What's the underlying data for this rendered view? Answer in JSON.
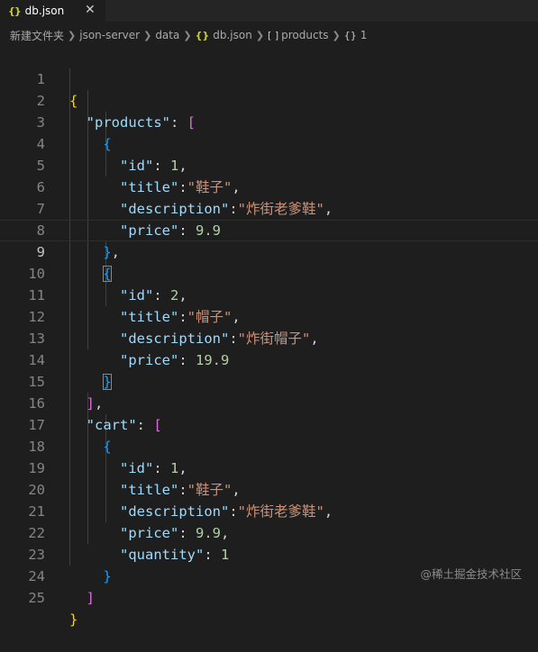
{
  "tab": {
    "icon": "{}",
    "label": "db.json",
    "close": "✕"
  },
  "breadcrumb": [
    "新建文件夹",
    "json-server",
    "data",
    "db.json",
    "products",
    "1"
  ],
  "line_numbers": [
    "1",
    "2",
    "3",
    "4",
    "5",
    "6",
    "7",
    "8",
    "9",
    "10",
    "11",
    "12",
    "13",
    "14",
    "15",
    "16",
    "17",
    "18",
    "19",
    "20",
    "21",
    "22",
    "23",
    "24",
    "25"
  ],
  "code": {
    "products_key": "\"products\"",
    "cart_key": "\"cart\"",
    "id_key": "\"id\"",
    "title_key": "\"title\"",
    "description_key": "\"description\"",
    "price_key": "\"price\"",
    "quantity_key": "\"quantity\"",
    "item1_id": "1",
    "item1_title": "\"鞋子\"",
    "item1_desc": "\"炸街老爹鞋\"",
    "item1_price": "9.9",
    "item2_id": "2",
    "item2_title": "\"帽子\"",
    "item2_desc": "\"炸街帽子\"",
    "item2_price": "19.9",
    "cart1_id": "1",
    "cart1_title": "\"鞋子\"",
    "cart1_desc": "\"炸街老爹鞋\"",
    "cart1_price": "9.9",
    "cart1_quantity": "1"
  },
  "watermark": "@稀土掘金技术社区",
  "colors": {
    "background": "#1e1e1e",
    "key": "#9cdcfe",
    "string": "#ce9178",
    "number": "#b5cea8",
    "bracket1": "#ffd700",
    "bracket2": "#da70d6",
    "bracket3": "#179fff"
  }
}
